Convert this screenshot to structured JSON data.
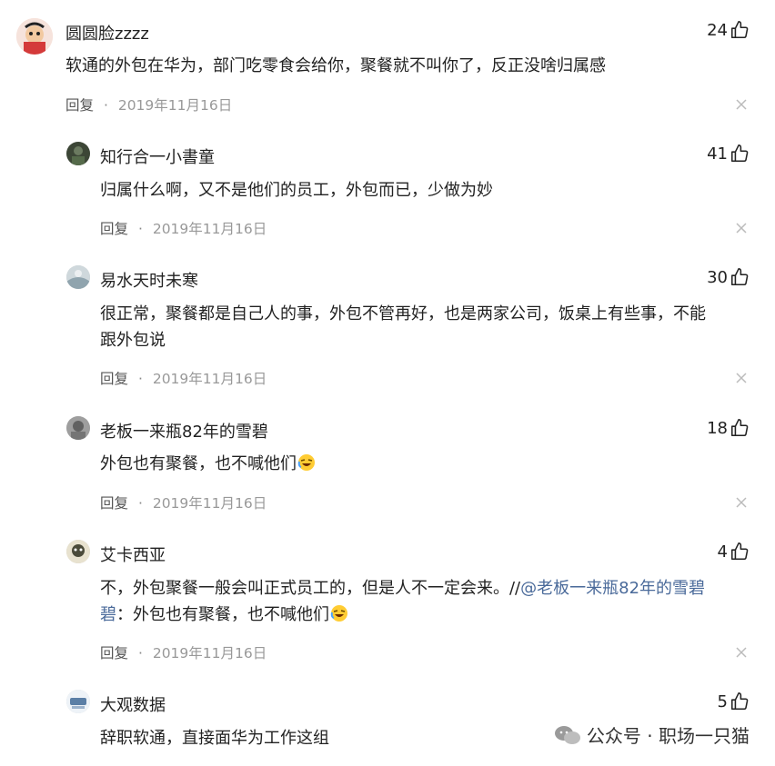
{
  "comments": [
    {
      "username": "圆圆脸zzzz",
      "likes": "24",
      "text": "软通的外包在华为，部门吃零食会给你，聚餐就不叫你了，反正没啥归属感",
      "reply_label": "回复",
      "sep": "·",
      "date": "2019年11月16日"
    },
    {
      "username": "知行合一小書童",
      "likes": "41",
      "text": "归属什么啊，又不是他们的员工，外包而已，少做为妙",
      "reply_label": "回复",
      "sep": "·",
      "date": "2019年11月16日"
    },
    {
      "username": "易水天时未寒",
      "likes": "30",
      "text_line1": "很正常，聚餐都是自己人的事，外包不管再好，也是两家公司，饭桌上有些事，不能",
      "text_line2": "跟外包说",
      "reply_label": "回复",
      "sep": "·",
      "date": "2019年11月16日"
    },
    {
      "username": "老板一来瓶82年的雪碧",
      "likes": "18",
      "text": "外包也有聚餐，也不喊他们",
      "reply_label": "回复",
      "sep": "·",
      "date": "2019年11月16日"
    },
    {
      "username": "艾卡西亚",
      "likes": "4",
      "text_part1": "不，外包聚餐一般会叫正式员工的，但是人不一定会来。//",
      "mention": "@老板一来瓶82年的雪碧",
      "text_part2_line1": "碧",
      "text_part2_rest": "：外包也有聚餐，也不喊他们",
      "reply_label": "回复",
      "sep": "·",
      "date": "2019年11月16日"
    },
    {
      "username": "大观数据",
      "likes": "5",
      "text": "辞职软通，直接面华为工作这组"
    }
  ],
  "watermark": {
    "text": "公众号 · 职场一只猫"
  }
}
